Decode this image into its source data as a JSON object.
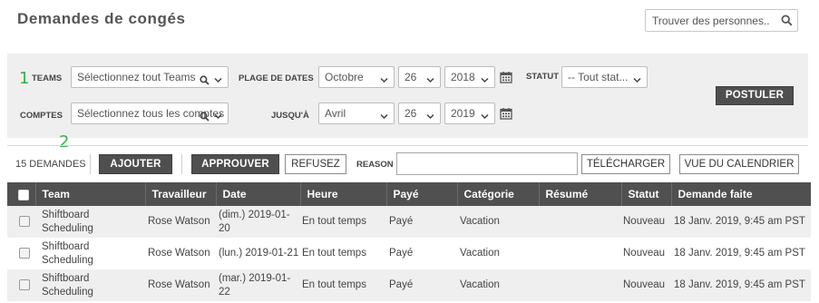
{
  "header": {
    "title": "Demandes de congés",
    "search_placeholder": "Trouver des personnes.."
  },
  "filters": {
    "marker_1": "1",
    "marker_2": "2",
    "teams_label": "TEAMS",
    "teams_value": "Sélectionnez tout Teams",
    "comptes_label": "COMPTES",
    "comptes_value": "Sélectionnez tous les comptes",
    "date_range_label": "PLAGE DE DATES",
    "from_month": "Octobre",
    "from_day": "26",
    "from_year": "2018",
    "until_label": "JUSQU'À",
    "to_month": "Avril",
    "to_day": "26",
    "to_year": "2019",
    "statut_label": "STATUT",
    "statut_value": "-- Tout stat...",
    "postuler_label": "POSTULER"
  },
  "toolbar": {
    "count_text": "15 DEMANDES",
    "ajouter_label": "AJOUTER",
    "approuver_label": "APPROUVER",
    "refusez_label": "REFUSEZ",
    "reason_label": "REASON",
    "reason_value": "",
    "telecharger_label": "TÉLÉCHARGER",
    "calendar_view_label": "VUE DU CALENDRIER"
  },
  "table": {
    "columns": [
      "Team",
      "Travailleur",
      "Date",
      "Heure",
      "Payé",
      "Catégorie",
      "Résumé",
      "Statut",
      "Demande faite"
    ],
    "rows": [
      {
        "team_line1": "Shiftboard",
        "team_line2": "Scheduling",
        "worker": "Rose Watson",
        "date": "(dim.) 2019-01-20",
        "time": "En tout temps",
        "paid": "Payé",
        "category": "Vacation",
        "summary": "",
        "status": "Nouveau",
        "requested": "18 Janv. 2019, 9:45 am PST"
      },
      {
        "team_line1": "Shiftboard",
        "team_line2": "Scheduling",
        "worker": "Rose Watson",
        "date": "(lun.) 2019-01-21",
        "time": "En tout temps",
        "paid": "Payé",
        "category": "Vacation",
        "summary": "",
        "status": "Nouveau",
        "requested": "18 Janv. 2019, 9:45 am PST"
      },
      {
        "team_line1": "Shiftboard",
        "team_line2": "Scheduling",
        "worker": "Rose Watson",
        "date": "(mar.) 2019-01-22",
        "time": "En tout temps",
        "paid": "Payé",
        "category": "Vacation",
        "summary": "",
        "status": "Nouveau",
        "requested": "18 Janv. 2019, 9:45 am PST"
      }
    ]
  },
  "colors": {
    "header_bg": "#505050",
    "button_dark": "#4f4f4f",
    "panel_bg": "#efefef",
    "marker_green": "#2fb34a"
  }
}
